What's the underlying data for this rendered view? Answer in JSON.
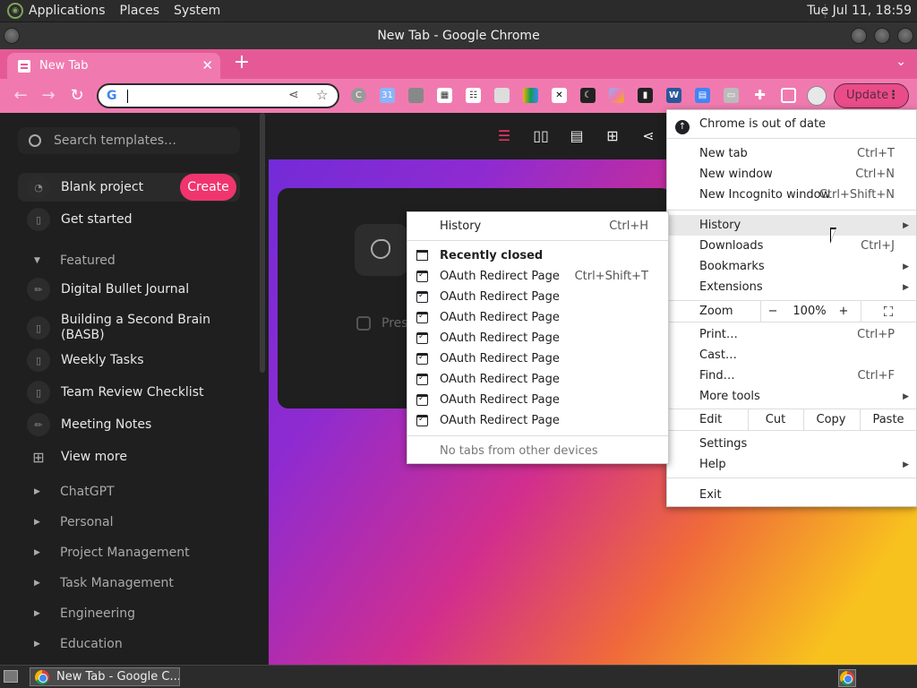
{
  "top_panel": {
    "menus": [
      "Applications",
      "Places",
      "System"
    ],
    "clock": "Tue Jul 11, 18:59"
  },
  "window": {
    "title": "New Tab - Google Chrome"
  },
  "tab": {
    "title": "New Tab",
    "close": "✕"
  },
  "toolbar": {
    "update_label": "Update",
    "omnibox_value": ""
  },
  "left_panel": {
    "search_placeholder": "Search templates…",
    "create_label": "Create",
    "items_top": [
      {
        "label": "Blank project",
        "icon": "page-icon"
      },
      {
        "label": "Get started",
        "icon": "doc-icon"
      }
    ],
    "featured_label": "Featured",
    "featured_items": [
      {
        "label": "Digital Bullet Journal",
        "icon": "pen-icon"
      },
      {
        "label": "Building a Second Brain (BASB)",
        "icon": "doc-icon"
      },
      {
        "label": "Weekly Tasks",
        "icon": "doc-icon"
      },
      {
        "label": "Team Review Checklist",
        "icon": "doc-icon"
      },
      {
        "label": "Meeting Notes",
        "icon": "pen-icon"
      },
      {
        "label": "View more",
        "icon": "grid-icon"
      }
    ],
    "sections": [
      "ChatGPT",
      "Personal",
      "Project Management",
      "Task Management",
      "Engineering",
      "Education"
    ]
  },
  "hero": {
    "text": "Pres"
  },
  "chrome_menu": {
    "update_notice": "Chrome is out of date",
    "new_tab": {
      "label": "New tab",
      "shortcut": "Ctrl+T"
    },
    "new_window": {
      "label": "New window",
      "shortcut": "Ctrl+N"
    },
    "new_incognito": {
      "label": "New Incognito window",
      "shortcut": "Ctrl+Shift+N"
    },
    "history": {
      "label": "History"
    },
    "downloads": {
      "label": "Downloads",
      "shortcut": "Ctrl+J"
    },
    "bookmarks": {
      "label": "Bookmarks"
    },
    "extensions": {
      "label": "Extensions"
    },
    "zoom": {
      "label": "Zoom",
      "minus": "−",
      "value": "100%",
      "plus": "+"
    },
    "print": {
      "label": "Print…",
      "shortcut": "Ctrl+P"
    },
    "cast": {
      "label": "Cast…"
    },
    "find": {
      "label": "Find…",
      "shortcut": "Ctrl+F"
    },
    "more_tools": {
      "label": "More tools"
    },
    "edit": {
      "label": "Edit",
      "cut": "Cut",
      "copy": "Copy",
      "paste": "Paste"
    },
    "settings": {
      "label": "Settings"
    },
    "help": {
      "label": "Help"
    },
    "exit": {
      "label": "Exit"
    }
  },
  "history_menu": {
    "history": {
      "label": "History",
      "shortcut": "Ctrl+H"
    },
    "recently_closed": "Recently closed",
    "entries": [
      {
        "label": "OAuth Redirect Page",
        "shortcut": "Ctrl+Shift+T"
      },
      {
        "label": "OAuth Redirect Page",
        "shortcut": ""
      },
      {
        "label": "OAuth Redirect Page",
        "shortcut": ""
      },
      {
        "label": "OAuth Redirect Page",
        "shortcut": ""
      },
      {
        "label": "OAuth Redirect Page",
        "shortcut": ""
      },
      {
        "label": "OAuth Redirect Page",
        "shortcut": ""
      },
      {
        "label": "OAuth Redirect Page",
        "shortcut": ""
      },
      {
        "label": "OAuth Redirect Page",
        "shortcut": ""
      }
    ],
    "no_other_devices": "No tabs from other devices"
  },
  "taskbar": {
    "task_label": "New Tab - Google C..."
  },
  "colors": {
    "accent": "#f07ab0",
    "tab_strip": "#e55a96",
    "create_button": "#f0356e"
  }
}
